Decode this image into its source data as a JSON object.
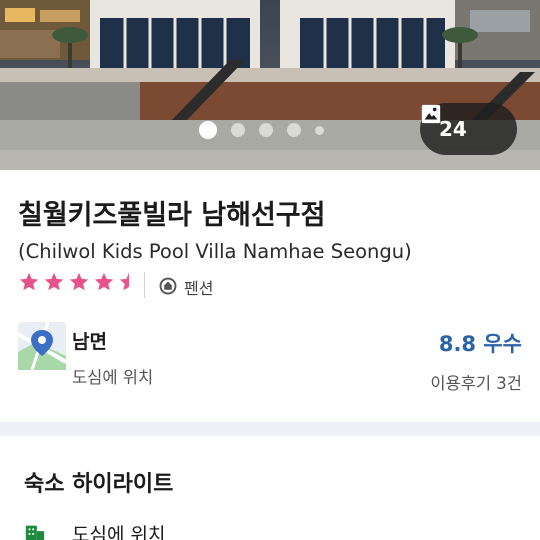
{
  "gallery": {
    "photo_count": "24",
    "dots_total": 5,
    "active_index": 0
  },
  "property": {
    "name": "칠월키즈풀빌라 남해선구점",
    "name_en": "(Chilwol Kids Pool Villa Namhae Seongu)",
    "star_rating": 4.5,
    "type": "펜션"
  },
  "location": {
    "area": "남면",
    "description": "도심에 위치"
  },
  "review": {
    "score_text": "8.8 우수",
    "count_text": "이용후기 3건"
  },
  "highlights": {
    "title": "숙소 하이라이트",
    "items": [
      {
        "label": "도심에 위치",
        "icon": "building-icon"
      }
    ]
  },
  "colors": {
    "star": "#e8528a",
    "rating": "#2b63a8",
    "highlight_icon": "#1e8a3e",
    "section_bg": "#eef0f8"
  }
}
